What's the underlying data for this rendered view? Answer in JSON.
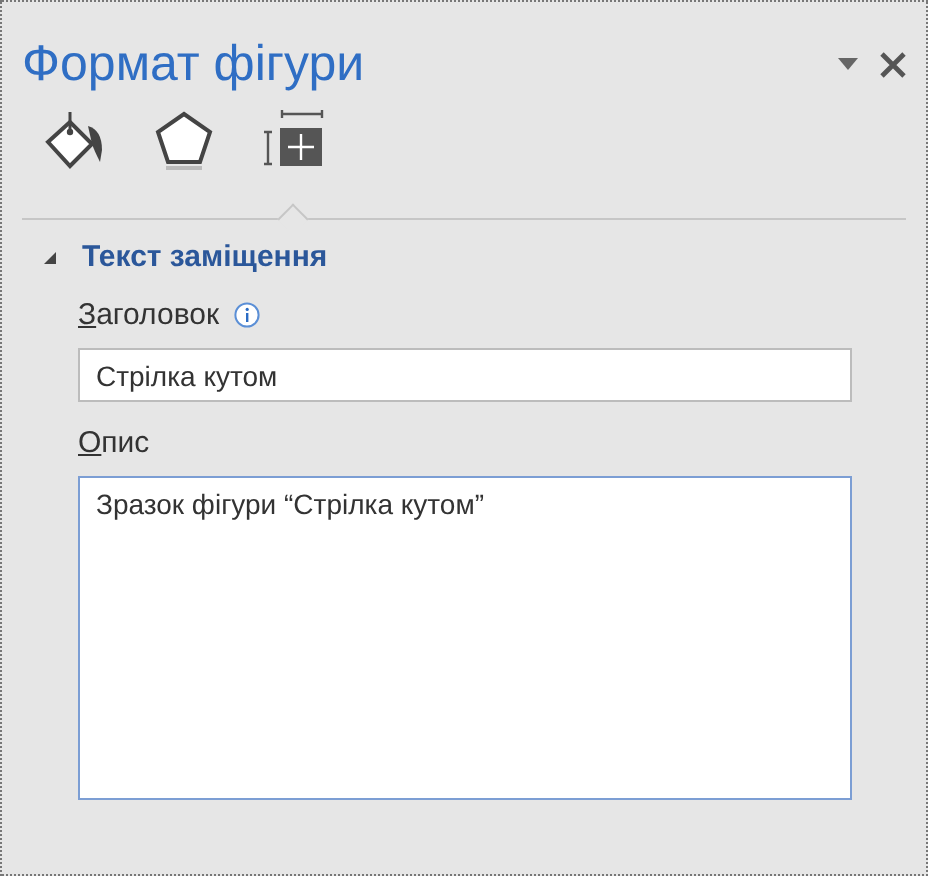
{
  "pane": {
    "title": "Формат фігури"
  },
  "tabs": [
    {
      "kind": "fill",
      "selected": false
    },
    {
      "kind": "shape",
      "selected": false
    },
    {
      "kind": "layout",
      "selected": true
    }
  ],
  "section": {
    "title": "Текст заміщення",
    "expanded": true
  },
  "fields": [
    {
      "label": "Заголовок",
      "value": "Стрілка кутом",
      "info": true,
      "kind": "line",
      "focused": false
    },
    {
      "label": "Опис",
      "value": "Зразок фігури “Стрілка кутом”",
      "info": false,
      "kind": "area",
      "focused": true
    }
  ]
}
